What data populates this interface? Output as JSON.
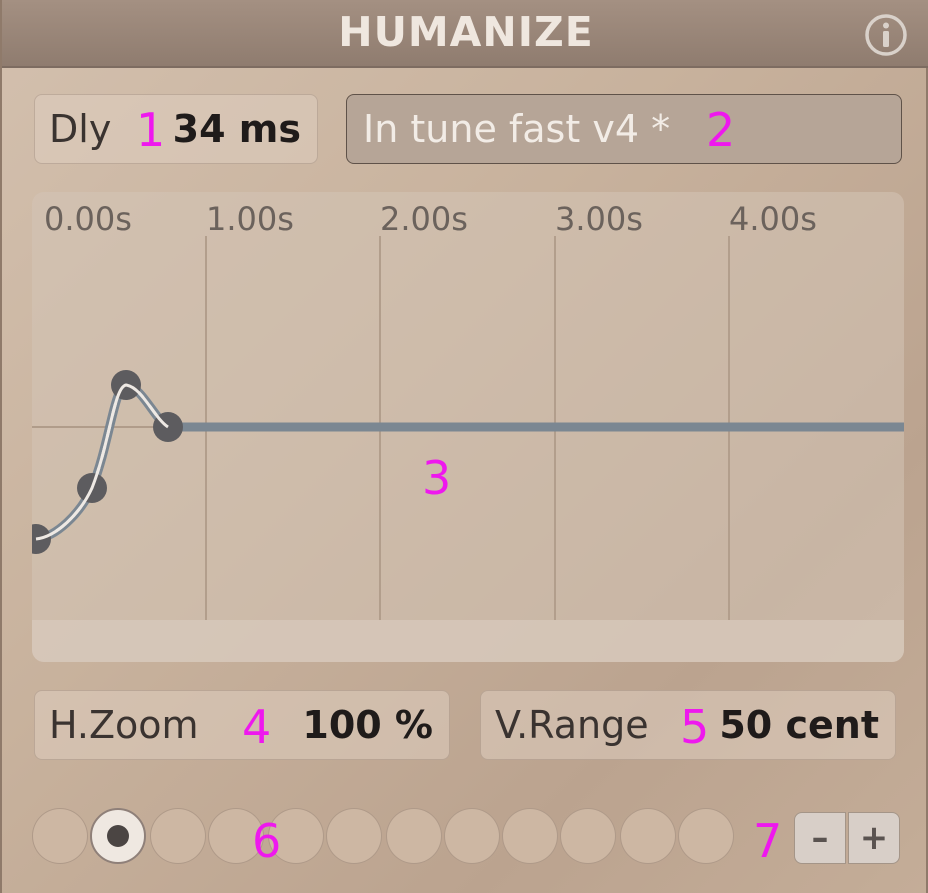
{
  "header": {
    "title": "HUMANIZE",
    "info_icon": "info-icon"
  },
  "delay": {
    "label": "Dly",
    "value": "34 ms"
  },
  "preset": {
    "name": "In tune fast v4 *"
  },
  "graph": {
    "time_ticks": [
      "0.00s",
      "1.00s",
      "2.00s",
      "3.00s",
      "4.00s"
    ],
    "curve_color": "#7b8792",
    "grid_color": "#b29e8c"
  },
  "h_zoom": {
    "label": "H.Zoom",
    "value": "100 %"
  },
  "v_range": {
    "label": "V.Range",
    "value": "50 cent"
  },
  "slots": {
    "count": 12,
    "selected_index": 1
  },
  "stepper": {
    "minus": "–",
    "plus": "+"
  },
  "annotations": [
    "1",
    "2",
    "3",
    "4",
    "5",
    "6",
    "7"
  ]
}
